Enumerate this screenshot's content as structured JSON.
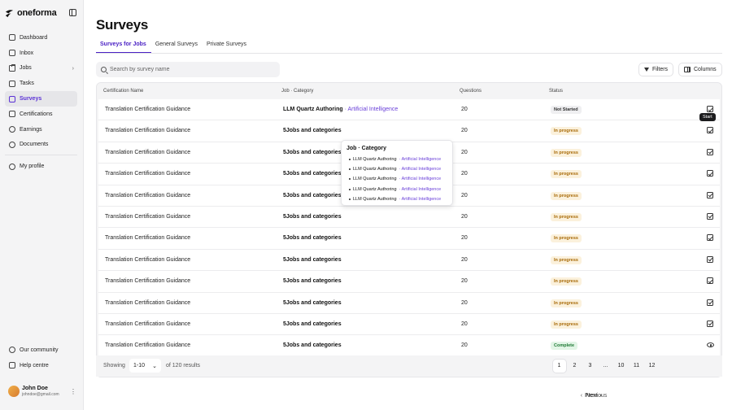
{
  "brand": {
    "name": "oneforma"
  },
  "sidebar": {
    "items": [
      {
        "label": "Dashboard"
      },
      {
        "label": "Inbox"
      },
      {
        "label": "Jobs"
      },
      {
        "label": "Tasks"
      },
      {
        "label": "Surveys"
      },
      {
        "label": "Certifications"
      },
      {
        "label": "Earnings"
      },
      {
        "label": "Documents"
      },
      {
        "label": "My profile"
      }
    ],
    "bottom": [
      {
        "label": "Our community"
      },
      {
        "label": "Help centre"
      }
    ],
    "user": {
      "name": "John Doe",
      "email": "johndoe@gmail.com"
    }
  },
  "page": {
    "title": "Surveys"
  },
  "tabs": [
    {
      "label": "Surveys for Jobs"
    },
    {
      "label": "General Surveys"
    },
    {
      "label": "Private Surveys"
    }
  ],
  "search": {
    "placeholder": "Search by survey name"
  },
  "toolbar": {
    "filters_label": "Filters",
    "columns_label": "Columns"
  },
  "table": {
    "headers": {
      "name": "Certification Name",
      "job": "Job · Category",
      "questions": "Questions",
      "status": "Status"
    },
    "rows": [
      {
        "name": "Translation Certification Guidance",
        "job": "LLM Quartz Authoring",
        "category": " · Artificial Intelligence",
        "questions": "20",
        "status": "Not Started",
        "action": "start"
      },
      {
        "name": "Translation Certification Guidance",
        "job": "5Jobs and categories",
        "category": "",
        "questions": "20",
        "status": "In progress",
        "action": "start"
      },
      {
        "name": "Translation Certification Guidance",
        "job": "5Jobs and categories",
        "category": "",
        "questions": "20",
        "status": "In progress",
        "action": "start"
      },
      {
        "name": "Translation Certification Guidance",
        "job": "5Jobs and categories",
        "category": "",
        "questions": "20",
        "status": "In progress",
        "action": "start"
      },
      {
        "name": "Translation Certification Guidance",
        "job": "5Jobs and categories",
        "category": "",
        "questions": "20",
        "status": "In progress",
        "action": "start"
      },
      {
        "name": "Translation Certification Guidance",
        "job": "5Jobs and categories",
        "category": "",
        "questions": "20",
        "status": "In progress",
        "action": "start"
      },
      {
        "name": "Translation Certification Guidance",
        "job": "5Jobs and categories",
        "category": "",
        "questions": "20",
        "status": "In progress",
        "action": "start"
      },
      {
        "name": "Translation Certification Guidance",
        "job": "5Jobs and categories",
        "category": "",
        "questions": "20",
        "status": "In progress",
        "action": "start"
      },
      {
        "name": "Translation Certification Guidance",
        "job": "5Jobs and categories",
        "category": "",
        "questions": "20",
        "status": "In progress",
        "action": "start"
      },
      {
        "name": "Translation Certification Guidance",
        "job": "5Jobs and categories",
        "category": "",
        "questions": "20",
        "status": "In progress",
        "action": "start"
      },
      {
        "name": "Translation Certification Guidance",
        "job": "5Jobs and categories",
        "category": "",
        "questions": "20",
        "status": "In progress",
        "action": "start"
      },
      {
        "name": "Translation Certification Guidance",
        "job": "5Jobs and categories",
        "category": "",
        "questions": "20",
        "status": "Complete",
        "action": "view"
      }
    ]
  },
  "tooltip": {
    "label": "Start"
  },
  "popover": {
    "title": "Job · Category",
    "items": [
      {
        "job": "LLM Quartz Authoring",
        "category": " · Artificial Intelligence"
      },
      {
        "job": "LLM Quartz Authoring",
        "category": " · Artificial Intelligence"
      },
      {
        "job": "LLM Quartz Authoring",
        "category": " · Artificial Intelligence"
      },
      {
        "job": "LLM Quartz Authoring",
        "category": " · Artificial Intelligence"
      },
      {
        "job": "LLM Quartz Authoring",
        "category": " · Artificial Intelligence"
      }
    ]
  },
  "footer": {
    "showing_label": "Showing",
    "range": "1-10",
    "results": "of 120 results",
    "prev_label": "Previous",
    "next_label": "Next",
    "pages": [
      "1",
      "2",
      "3",
      "...",
      "10",
      "11",
      "12"
    ],
    "current_page": "1"
  },
  "colors": {
    "accent": "#4a21c4",
    "in_progress": "#a86a07",
    "complete": "#1f7a35"
  }
}
